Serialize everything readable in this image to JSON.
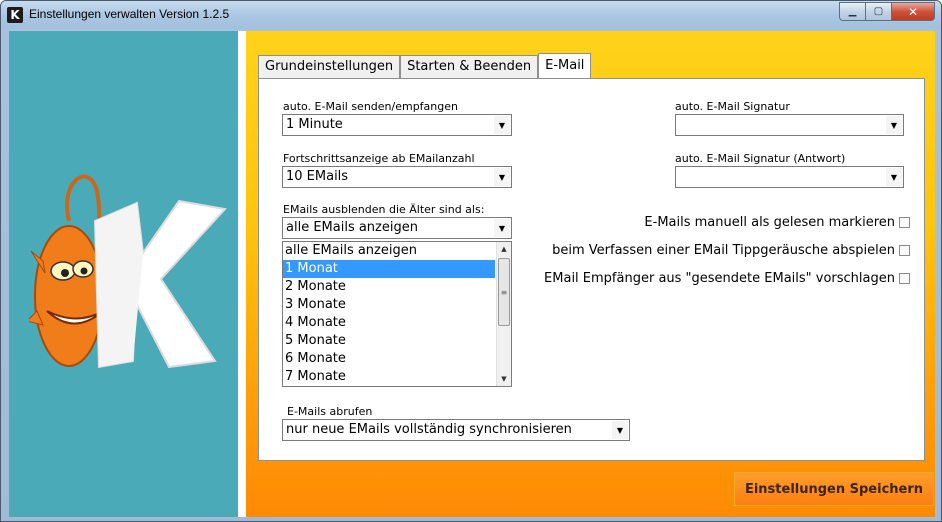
{
  "window": {
    "title": "Einstellungen verwalten Version 1.2.5",
    "app_icon_letter": "K"
  },
  "tabs": [
    {
      "label": "Grundeinstellungen",
      "active": false
    },
    {
      "label": "Starten & Beenden",
      "active": false
    },
    {
      "label": "E-Mail",
      "active": true
    }
  ],
  "email": {
    "auto_send": {
      "label": "auto. E-Mail senden/empfangen",
      "value": "1 Minute"
    },
    "progress": {
      "label": "Fortschrittsanzeige ab EMailanzahl",
      "value": "10 EMails"
    },
    "hide_older": {
      "label": "EMails ausblenden die Älter sind als:",
      "value": "alle EMails anzeigen",
      "options": [
        "alle EMails anzeigen",
        "1 Monat",
        "2 Monate",
        "3 Monate",
        "4 Monate",
        "5 Monate",
        "6 Monate",
        "7 Monate"
      ],
      "highlighted": "1 Monat"
    },
    "signature": {
      "label": "auto. E-Mail Signatur",
      "value": ""
    },
    "signature_reply": {
      "label": "auto. E-Mail Signatur (Antwort)",
      "value": ""
    },
    "checkboxes": [
      {
        "label": "E-Mails manuell als gelesen markieren",
        "checked": false
      },
      {
        "label": "beim Verfassen einer EMail Tippgeräusche abspielen",
        "checked": false
      },
      {
        "label": "EMail Empfänger aus \"gesendete EMails\" vorschlagen",
        "checked": false
      }
    ],
    "fetch": {
      "label": "E-Mails abrufen",
      "value": "nur neue EMails vollständig synchronisieren"
    }
  },
  "save_button": {
    "label": "Einstellungen Speichern"
  },
  "colors": {
    "left_panel": "#4aaab8",
    "accent_orange": "#ff8a05",
    "accent_yellow": "#ffd21a",
    "selection": "#3399ff"
  }
}
